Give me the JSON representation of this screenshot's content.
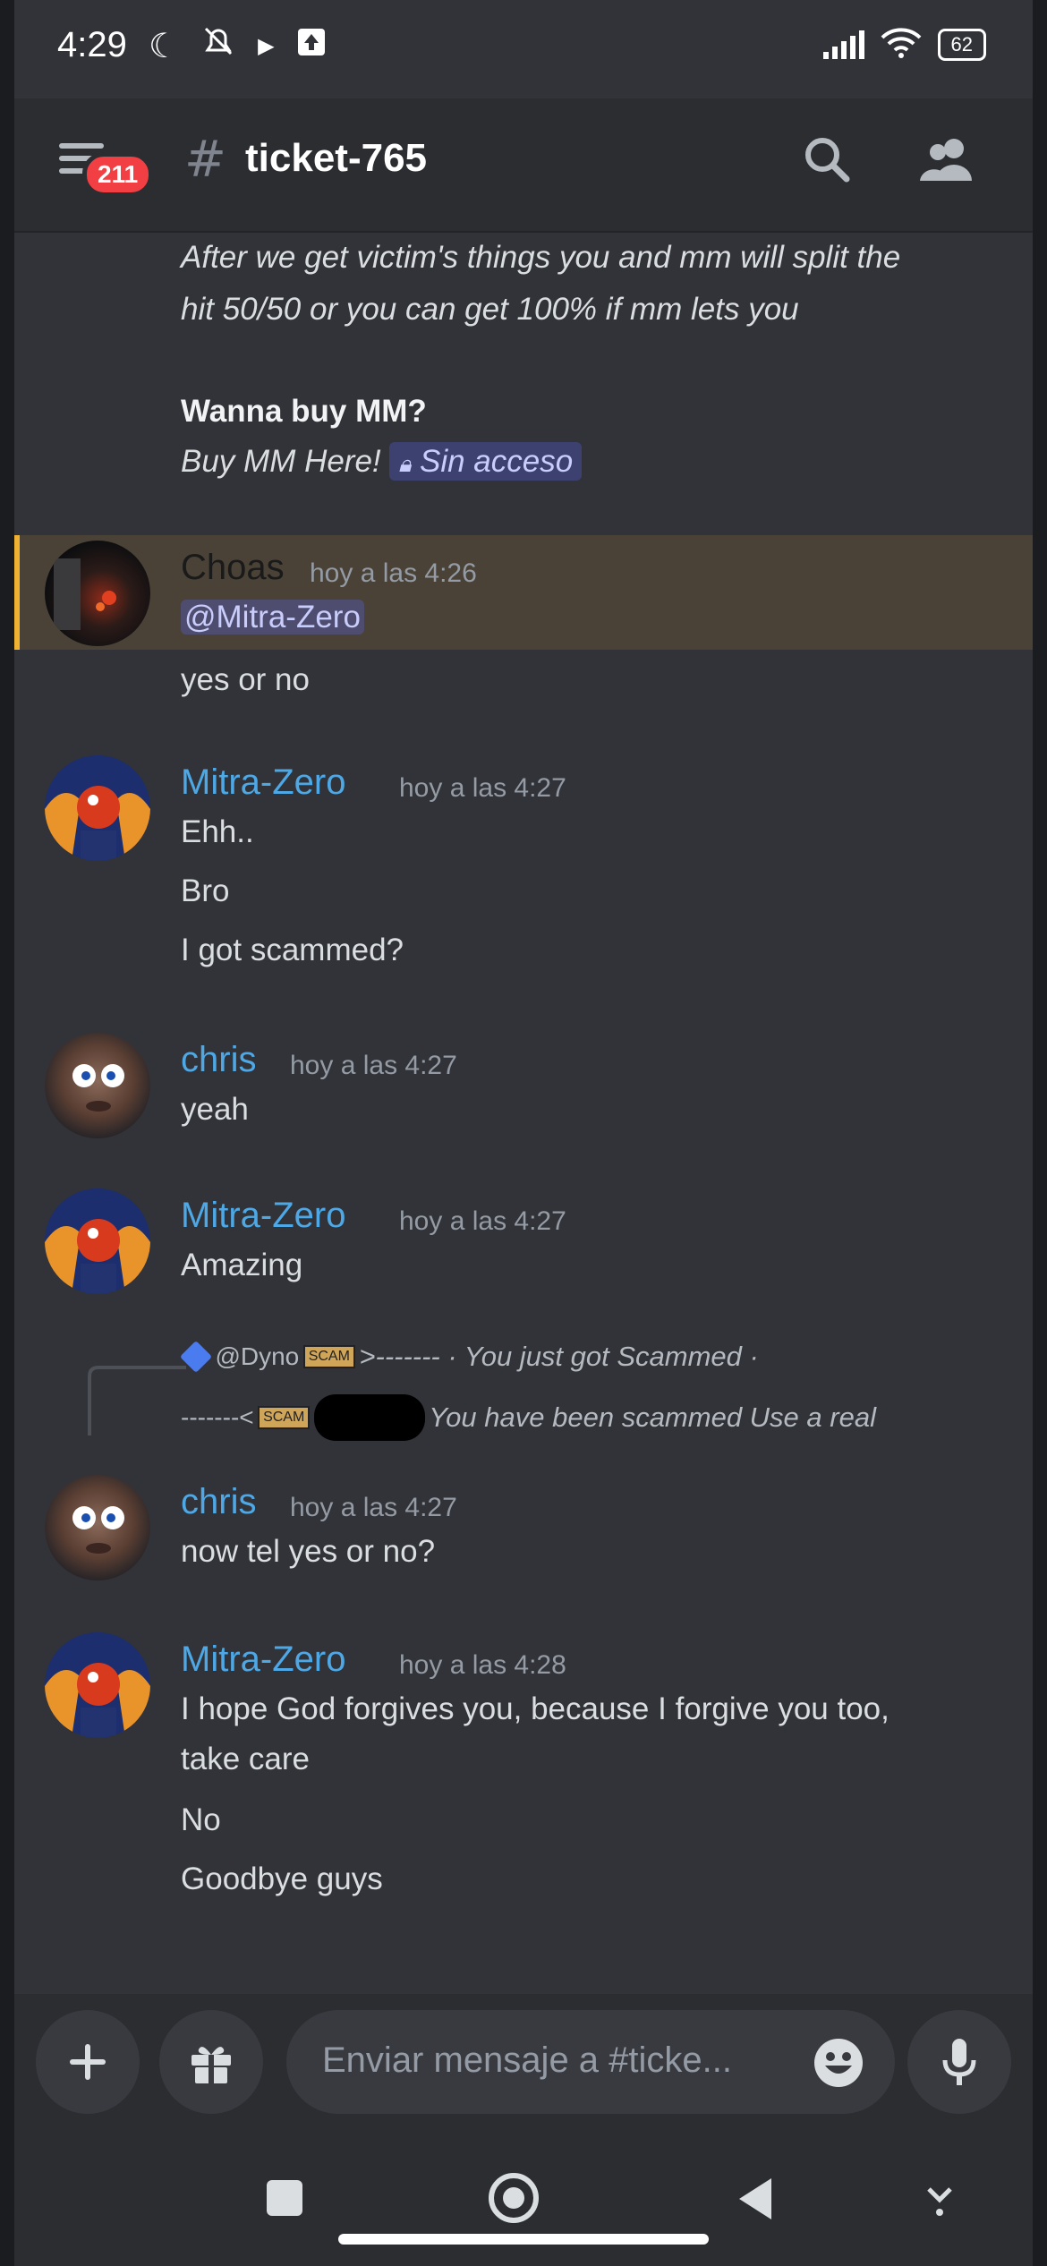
{
  "status_bar": {
    "time": "4:29",
    "battery": "62"
  },
  "header": {
    "badge_count": "211",
    "channel_name": "ticket-765"
  },
  "messages": {
    "continuation": {
      "line1": "After we get victim's things you and mm will split the",
      "line2": "hit 50/50 or you can get 100% if mm lets you",
      "bold": "Wanna buy MM?",
      "buy_text": "Buy MM Here!",
      "link_text": "Sin acceso"
    },
    "m1": {
      "author": "Choas",
      "time": "hoy a las 4:26",
      "mention": "@Mitra-Zero",
      "lines": [
        "yes or no"
      ]
    },
    "m2": {
      "author": "Mitra-Zero",
      "time": "hoy a las 4:27",
      "lines": [
        "Ehh..",
        "Bro",
        "I got scammed?"
      ]
    },
    "m3": {
      "author": "chris",
      "time": "hoy a las 4:27",
      "lines": [
        "yeah"
      ]
    },
    "m4": {
      "author": "Mitra-Zero",
      "time": "hoy a las 4:27",
      "lines": [
        "Amazing"
      ]
    },
    "reply": {
      "author": "@Dyno",
      "emoji_text": "SCAM",
      "text1": ">------- · You just got Scammed ·",
      "text2": "-------<",
      "text3": "You have been scammed Use a real"
    },
    "m5": {
      "author": "chris",
      "time": "hoy a las 4:27",
      "lines": [
        "now tel yes or no?"
      ]
    },
    "m6": {
      "author": "Mitra-Zero",
      "time": "hoy a las 4:28",
      "lines": [
        "I hope God forgives you, because I forgive you too,",
        "take care",
        "No",
        "Goodbye guys"
      ]
    }
  },
  "composer": {
    "placeholder": "Enviar mensaje a #ticke..."
  },
  "colors": {
    "mitra": "#4ea8e6",
    "chris": "#4ea8e6",
    "choas": "#1a1a1a",
    "highlight": "#f0b232",
    "background": "#313338"
  }
}
